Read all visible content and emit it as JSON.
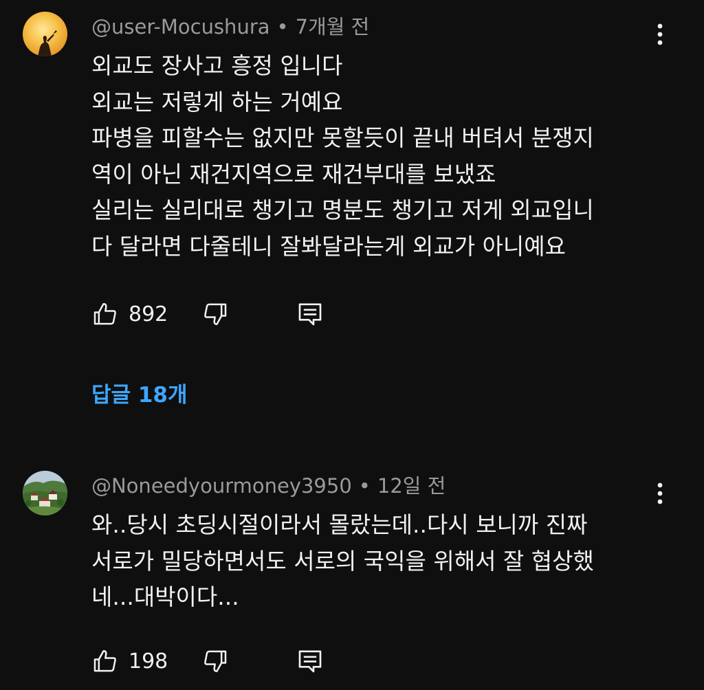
{
  "comments": [
    {
      "author": "@user-Mocushura",
      "time": "7개월 전",
      "lines": [
        "외교도 장사고 흥정 입니다",
        "외교는 저렇게 하는 거예요",
        "파병을 피할수는 없지만 못할듯이 끝내 버텨서 분쟁지",
        "역이 아닌 재건지역으로 재건부대를 보냈죠",
        "실리는 실리대로 챙기고 명분도 챙기고 저게 외교입니",
        "다 달라면 다줄테니 잘봐달라는게 외교가 아니예요"
      ],
      "likes": "892",
      "replies_label": "답글 18개"
    },
    {
      "author": "@Noneedyourmoney3950",
      "time": "12일 전",
      "lines": [
        "와..당시 초딩시절이라서 몰랐는데..다시 보니까 진짜",
        "서로가 밀당하면서도 서로의 국익을 위해서 잘 협상했",
        "네...대박이다..."
      ],
      "likes": "198"
    }
  ],
  "meta_separator": "•",
  "icons": {
    "like": "thumbs-up-icon",
    "dislike": "thumbs-down-icon",
    "reply": "reply-comment-icon",
    "more": "more-vert-icon"
  },
  "colors": {
    "background": "#0f0f0f",
    "text": "#f1f1f1",
    "meta": "#9a9a9a",
    "link": "#3ea6ff"
  }
}
